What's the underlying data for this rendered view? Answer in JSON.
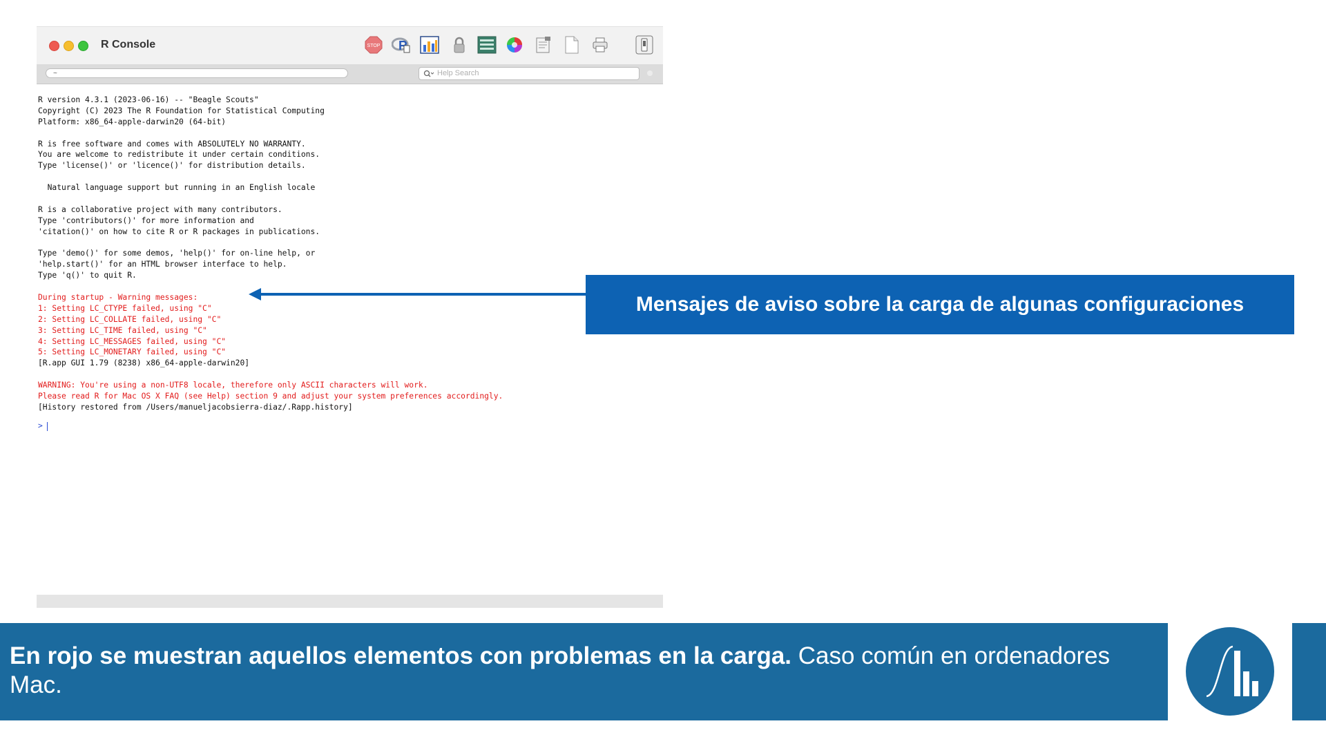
{
  "window": {
    "title": "R Console",
    "path_value": "~",
    "help_search_placeholder": "Help Search",
    "toolbar_icons": [
      "stop-icon",
      "r-source-icon",
      "chart-icon",
      "lock-icon",
      "list-icon",
      "color-wheel-icon",
      "document-edit-icon",
      "new-document-icon",
      "print-icon",
      "drawer-icon"
    ]
  },
  "console": {
    "lines": [
      {
        "text": "R version 4.3.1 (2023-06-16) -- \"Beagle Scouts\"",
        "type": "normal"
      },
      {
        "text": "Copyright (C) 2023 The R Foundation for Statistical Computing",
        "type": "normal"
      },
      {
        "text": "Platform: x86_64-apple-darwin20 (64-bit)",
        "type": "normal"
      },
      {
        "text": "",
        "type": "normal"
      },
      {
        "text": "R is free software and comes with ABSOLUTELY NO WARRANTY.",
        "type": "normal"
      },
      {
        "text": "You are welcome to redistribute it under certain conditions.",
        "type": "normal"
      },
      {
        "text": "Type 'license()' or 'licence()' for distribution details.",
        "type": "normal"
      },
      {
        "text": "",
        "type": "normal"
      },
      {
        "text": "  Natural language support but running in an English locale",
        "type": "normal"
      },
      {
        "text": "",
        "type": "normal"
      },
      {
        "text": "R is a collaborative project with many contributors.",
        "type": "normal"
      },
      {
        "text": "Type 'contributors()' for more information and",
        "type": "normal"
      },
      {
        "text": "'citation()' on how to cite R or R packages in publications.",
        "type": "normal"
      },
      {
        "text": "",
        "type": "normal"
      },
      {
        "text": "Type 'demo()' for some demos, 'help()' for on-line help, or",
        "type": "normal"
      },
      {
        "text": "'help.start()' for an HTML browser interface to help.",
        "type": "normal"
      },
      {
        "text": "Type 'q()' to quit R.",
        "type": "normal"
      },
      {
        "text": "",
        "type": "normal"
      },
      {
        "text": "During startup - Warning messages:",
        "type": "error"
      },
      {
        "text": "1: Setting LC_CTYPE failed, using \"C\"",
        "type": "error"
      },
      {
        "text": "2: Setting LC_COLLATE failed, using \"C\"",
        "type": "error"
      },
      {
        "text": "3: Setting LC_TIME failed, using \"C\"",
        "type": "error"
      },
      {
        "text": "4: Setting LC_MESSAGES failed, using \"C\"",
        "type": "error"
      },
      {
        "text": "5: Setting LC_MONETARY failed, using \"C\"",
        "type": "error"
      },
      {
        "text": "[R.app GUI 1.79 (8238) x86_64-apple-darwin20]",
        "type": "normal"
      },
      {
        "text": "",
        "type": "normal"
      },
      {
        "text": "WARNING: You're using a non-UTF8 locale, therefore only ASCII characters will work.",
        "type": "error"
      },
      {
        "text": "Please read R for Mac OS X FAQ (see Help) section 9 and adjust your system preferences accordingly.",
        "type": "error"
      },
      {
        "text": "[History restored from /Users/manueljacobsierra-diaz/.Rapp.history]",
        "type": "normal"
      }
    ],
    "prompt": ">"
  },
  "annotation": {
    "text": "Mensajes de aviso sobre la carga de algunas configuraciones"
  },
  "footer": {
    "bold_text": "En rojo se muestran aquellos elementos con problemas en la carga.",
    "regular_text": " Caso común en ordenadores Mac."
  },
  "colors": {
    "error_text": "#e21b1b",
    "annotation_bg": "#0d62b3",
    "footer_bg": "#1b6a9e",
    "prompt": "#2b4cd3"
  }
}
